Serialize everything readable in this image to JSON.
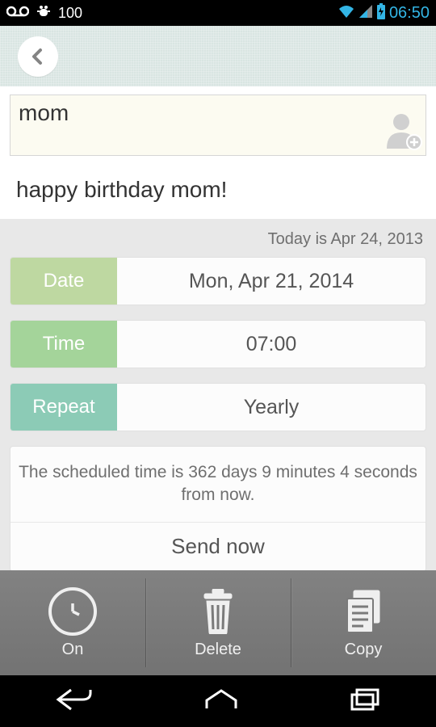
{
  "status": {
    "battery_text": "100",
    "clock": "06:50"
  },
  "recipient": "mom",
  "message": "happy birthday mom!",
  "today_line": "Today is Apr 24, 2013",
  "rows": {
    "date_label": "Date",
    "date_value": "Mon, Apr 21, 2014",
    "time_label": "Time",
    "time_value": "07:00",
    "repeat_label": "Repeat",
    "repeat_value": "Yearly"
  },
  "info_text": "The scheduled time is 362 days 9 minutes 4 seconds from now.",
  "send_now": "Send now",
  "toolbar": {
    "on": "On",
    "delete": "Delete",
    "copy": "Copy"
  }
}
